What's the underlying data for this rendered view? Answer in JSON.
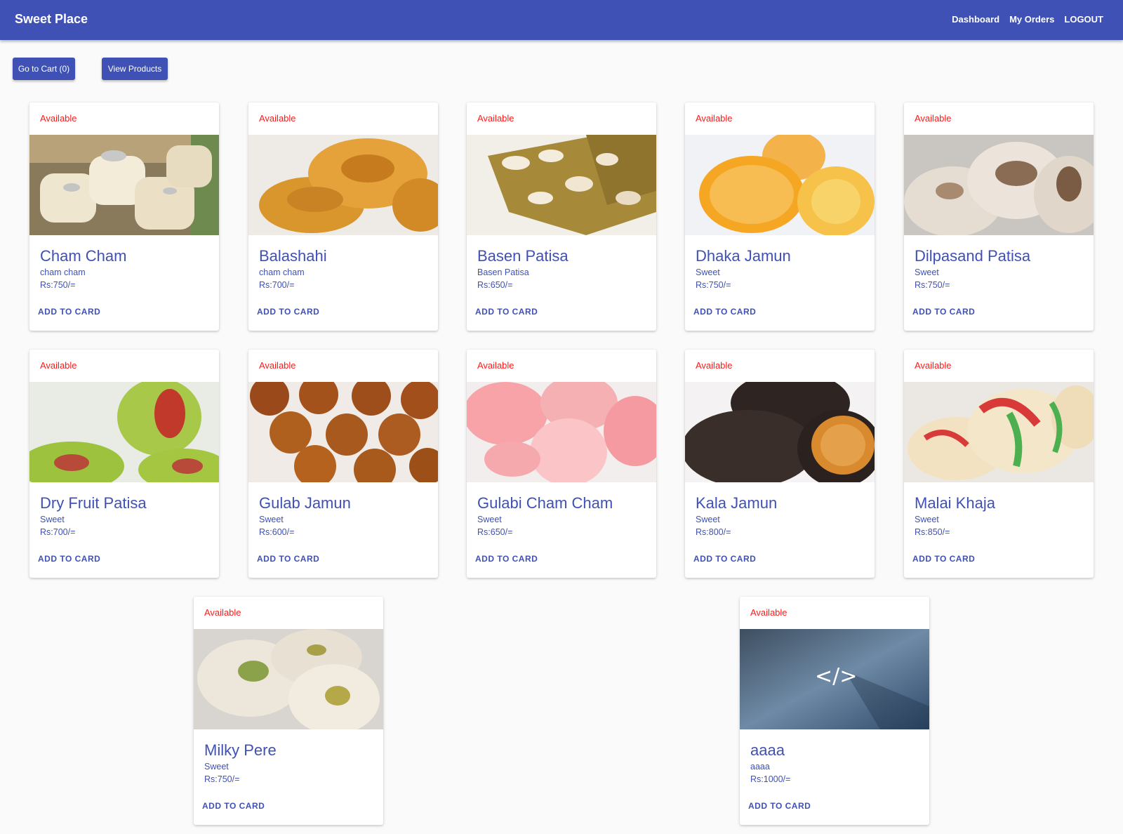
{
  "app": {
    "title": "Sweet Place"
  },
  "nav": {
    "dashboard": "Dashboard",
    "orders": "My Orders",
    "logout": "LOGOUT"
  },
  "actions": {
    "cart": "Go to Cart (0)",
    "view_products": "View Products"
  },
  "products": [
    {
      "status": "Available",
      "name": "Cham Cham",
      "desc": "cham cham",
      "price": "Rs:750/=",
      "button": "ADD TO CARD"
    },
    {
      "status": "Available",
      "name": "Balashahi",
      "desc": "cham cham",
      "price": "Rs:700/=",
      "button": "ADD TO CARD"
    },
    {
      "status": "Available",
      "name": "Basen Patisa",
      "desc": "Basen Patisa",
      "price": "Rs:650/=",
      "button": "ADD TO CARD"
    },
    {
      "status": "Available",
      "name": "Dhaka Jamun",
      "desc": "Sweet",
      "price": "Rs:750/=",
      "button": "ADD TO CARD"
    },
    {
      "status": "Available",
      "name": "Dilpasand Patisa",
      "desc": "Sweet",
      "price": "Rs:750/=",
      "button": "ADD TO CARD"
    },
    {
      "status": "Available",
      "name": "Dry Fruit Patisa",
      "desc": "Sweet",
      "price": "Rs:700/=",
      "button": "ADD TO CARD"
    },
    {
      "status": "Available",
      "name": "Gulab Jamun",
      "desc": "Sweet",
      "price": "Rs:600/=",
      "button": "ADD TO CARD"
    },
    {
      "status": "Available",
      "name": "Gulabi Cham Cham",
      "desc": "Sweet",
      "price": "Rs:650/=",
      "button": "ADD TO CARD"
    },
    {
      "status": "Available",
      "name": "Kala Jamun",
      "desc": "Sweet",
      "price": "Rs:800/=",
      "button": "ADD TO CARD"
    },
    {
      "status": "Available",
      "name": "Malai Khaja",
      "desc": "Sweet",
      "price": "Rs:850/=",
      "button": "ADD TO CARD"
    },
    {
      "status": "Available",
      "name": "Milky Pere",
      "desc": "Sweet",
      "price": "Rs:750/=",
      "button": "ADD TO CARD"
    },
    {
      "status": "Available",
      "name": "aaaa",
      "desc": "aaaa",
      "price": "Rs:1000/=",
      "button": "ADD TO CARD"
    }
  ],
  "colors": {
    "primary": "#3f51b5",
    "status": "#ff1a1a",
    "background": "#fafafa"
  }
}
